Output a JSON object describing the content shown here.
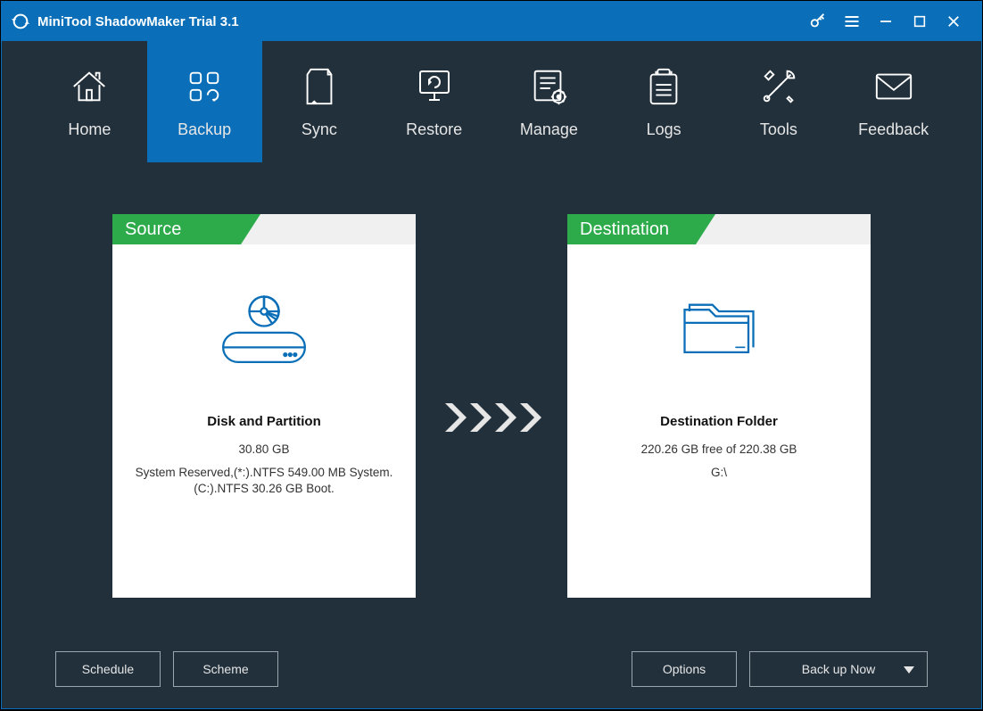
{
  "titlebar": {
    "title": "MiniTool ShadowMaker Trial 3.1"
  },
  "nav": {
    "items": [
      {
        "id": "home",
        "label": "Home"
      },
      {
        "id": "backup",
        "label": "Backup"
      },
      {
        "id": "sync",
        "label": "Sync"
      },
      {
        "id": "restore",
        "label": "Restore"
      },
      {
        "id": "manage",
        "label": "Manage"
      },
      {
        "id": "logs",
        "label": "Logs"
      },
      {
        "id": "tools",
        "label": "Tools"
      },
      {
        "id": "feedback",
        "label": "Feedback"
      }
    ],
    "active": "backup"
  },
  "source": {
    "tab": "Source",
    "title": "Disk and Partition",
    "size": "30.80 GB",
    "details": "System Reserved,(*:).NTFS 549.00 MB System. (C:).NTFS 30.26 GB Boot."
  },
  "destination": {
    "tab": "Destination",
    "title": "Destination Folder",
    "free": "220.26 GB free of 220.38 GB",
    "path": "G:\\"
  },
  "footer": {
    "schedule": "Schedule",
    "scheme": "Scheme",
    "options": "Options",
    "backup_now": "Back up Now"
  }
}
